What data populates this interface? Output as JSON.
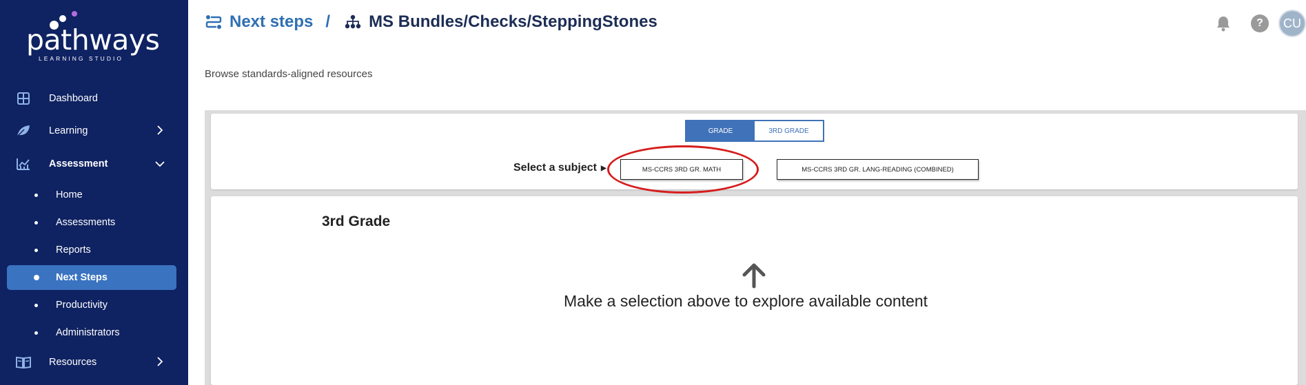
{
  "brand": {
    "logo_text": "pathways",
    "logo_subtext": "LEARNING STUDIO",
    "colors": {
      "sidebar": "#0f2262",
      "accent": "#3a73c0",
      "highlight": "#d61d1d"
    }
  },
  "sidebar": {
    "items": [
      {
        "label": "Dashboard",
        "icon": "dashboard-icon"
      },
      {
        "label": "Learning",
        "icon": "leaf-icon",
        "chevron": "›"
      },
      {
        "label": "Assessment",
        "icon": "chart-icon",
        "chevron": "⌄"
      },
      {
        "label": "Resources",
        "icon": "book-icon",
        "chevron": "›"
      }
    ],
    "assessment_sub": [
      {
        "label": "Home"
      },
      {
        "label": "Assessments"
      },
      {
        "label": "Reports"
      },
      {
        "label": "Next Steps",
        "active": true
      },
      {
        "label": "Productivity"
      },
      {
        "label": "Administrators"
      }
    ]
  },
  "header": {
    "crumb1": "Next steps",
    "separator": "/",
    "crumb2": "MS Bundles/Checks/SteppingStones",
    "help_glyph": "?",
    "avatar_initials": "CU"
  },
  "page": {
    "subtitle": "Browse standards-aligned resources"
  },
  "filter": {
    "toggle": [
      "GRADE",
      "3RD GRADE"
    ],
    "subject_label": "Select a subject",
    "subjects": [
      "MS-CCRS 3RD GR. MATH",
      "MS-CCRS 3RD GR. LANG-READING (COMBINED)"
    ]
  },
  "main": {
    "grade_title": "3rd Grade",
    "empty_message": "Make a selection above to explore available content"
  }
}
